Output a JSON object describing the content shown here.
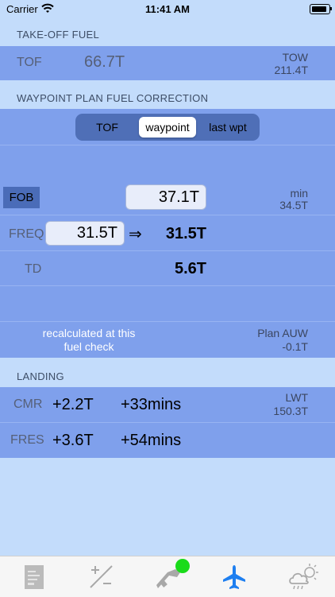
{
  "status_bar": {
    "carrier": "Carrier",
    "time": "11:41 AM"
  },
  "takeoff": {
    "header": "TAKE-OFF FUEL",
    "tof_label": "TOF",
    "tof_value": "66.7T",
    "tow_label": "TOW",
    "tow_value": "211.4T"
  },
  "waypoint": {
    "header": "WAYPOINT PLAN FUEL CORRECTION",
    "segments": [
      "TOF",
      "waypoint",
      "last wpt"
    ],
    "selected_segment": "waypoint",
    "fob_label": "FOB",
    "fob_value": "37.1T",
    "min_label": "min",
    "min_value": "34.5T",
    "freq_label": "FREQ",
    "freq_value": "31.5T",
    "arrow": "⇒",
    "freq_result": "31.5T",
    "td_label": "TD",
    "td_value": "5.6T",
    "recalc_note_line1": "recalculated at this",
    "recalc_note_line2": "fuel check",
    "plan_auw_label": "Plan AUW",
    "plan_auw_value": "-0.1T"
  },
  "landing": {
    "header": "LANDING",
    "cmr_label": "CMR",
    "cmr_fuel": "+2.2T",
    "cmr_time": "+33mins",
    "lwt_label": "LWT",
    "lwt_value": "150.3T",
    "fres_label": "FRES",
    "fres_fuel": "+3.6T",
    "fres_time": "+54mins"
  },
  "tab_bar": {
    "icons": [
      "document-icon",
      "plus-minus-slash-icon",
      "fuel-nozzle-icon",
      "airplane-icon",
      "cloud-weather-icon"
    ],
    "selected": "airplane-icon",
    "badge_color": "#1adb1a"
  },
  "colors": {
    "accent": "#1e7ff0",
    "band": "#7fa0ec",
    "background": "#c3dcfb"
  }
}
